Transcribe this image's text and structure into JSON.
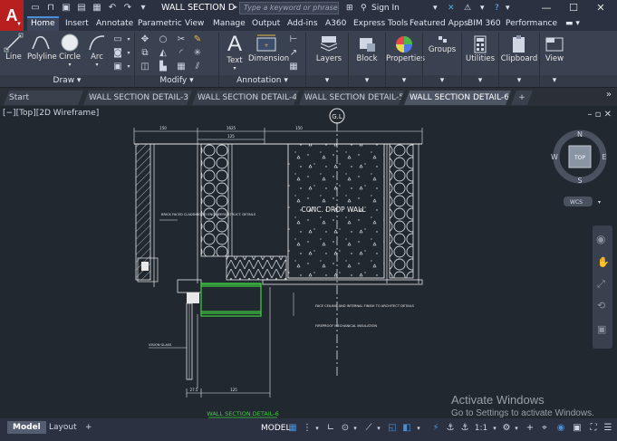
{
  "app": {
    "logo_letter": "A",
    "document_title": "WALL SECTION DETAI...",
    "search_placeholder": "Type a keyword or phrase",
    "sign_in": "Sign In",
    "help": "?"
  },
  "menu_tabs": [
    "Home",
    "Insert",
    "Annotate",
    "Parametric",
    "View",
    "Manage",
    "Output",
    "Add-ins",
    "A360",
    "Express Tools",
    "Featured Apps",
    "BIM 360",
    "Performance"
  ],
  "ribbon": {
    "draw_tools": [
      "Line",
      "Polyline",
      "Circle",
      "Arc"
    ],
    "draw_footer": "Draw",
    "modify_footer": "Modify",
    "annotation_tools": [
      "Text",
      "Dimension"
    ],
    "annotation_footer": "Annotation",
    "big_tools": [
      "Layers",
      "Block",
      "Properties",
      "Groups",
      "Utilities",
      "Clipboard",
      "View"
    ]
  },
  "file_tabs": [
    {
      "label": "Start",
      "active": false
    },
    {
      "label": "WALL SECTION DETAIL-3",
      "active": false
    },
    {
      "label": "WALL SECTION DETAIL-4",
      "active": false
    },
    {
      "label": "WALL SECTION DETAIL-5",
      "active": false
    },
    {
      "label": "WALL SECTION DETAIL-6",
      "active": true
    }
  ],
  "viewport": {
    "label": "[−][Top][2D Wireframe]",
    "view_cube": {
      "top": "TOP",
      "n": "N",
      "s": "S",
      "e": "E",
      "w": "W",
      "wcs": "WCS"
    }
  },
  "drawing": {
    "grid_label": "G.L",
    "main_label": "CONC. DROP WALL",
    "title": "WALL SECTION DETAIL-6",
    "dims_top": [
      "150",
      "1625",
      "150",
      "125"
    ],
    "dims_bottom": [
      "27.5",
      "125"
    ],
    "notes": [
      "BRICK FACED CLADDING TO ENGINEERS STRUCT. DETAILS",
      "FACE CEILING AND INTERNAL FINISH TO ARCHITECT DETAILS",
      "FIREPROOF MECHANICAL INSULATION",
      "VISION GLASS"
    ],
    "colors": {
      "line": "#e8e8e8",
      "accent_green": "#3fd23f",
      "title_green": "#3fd23f",
      "background": "#212830"
    }
  },
  "statusbar": {
    "tabs": [
      "Model",
      "Layout"
    ],
    "model_label": "MODEL",
    "scale": "1:1"
  },
  "watermark": {
    "line1": "Activate Windows",
    "line2": "Go to Settings to activate Windows."
  }
}
